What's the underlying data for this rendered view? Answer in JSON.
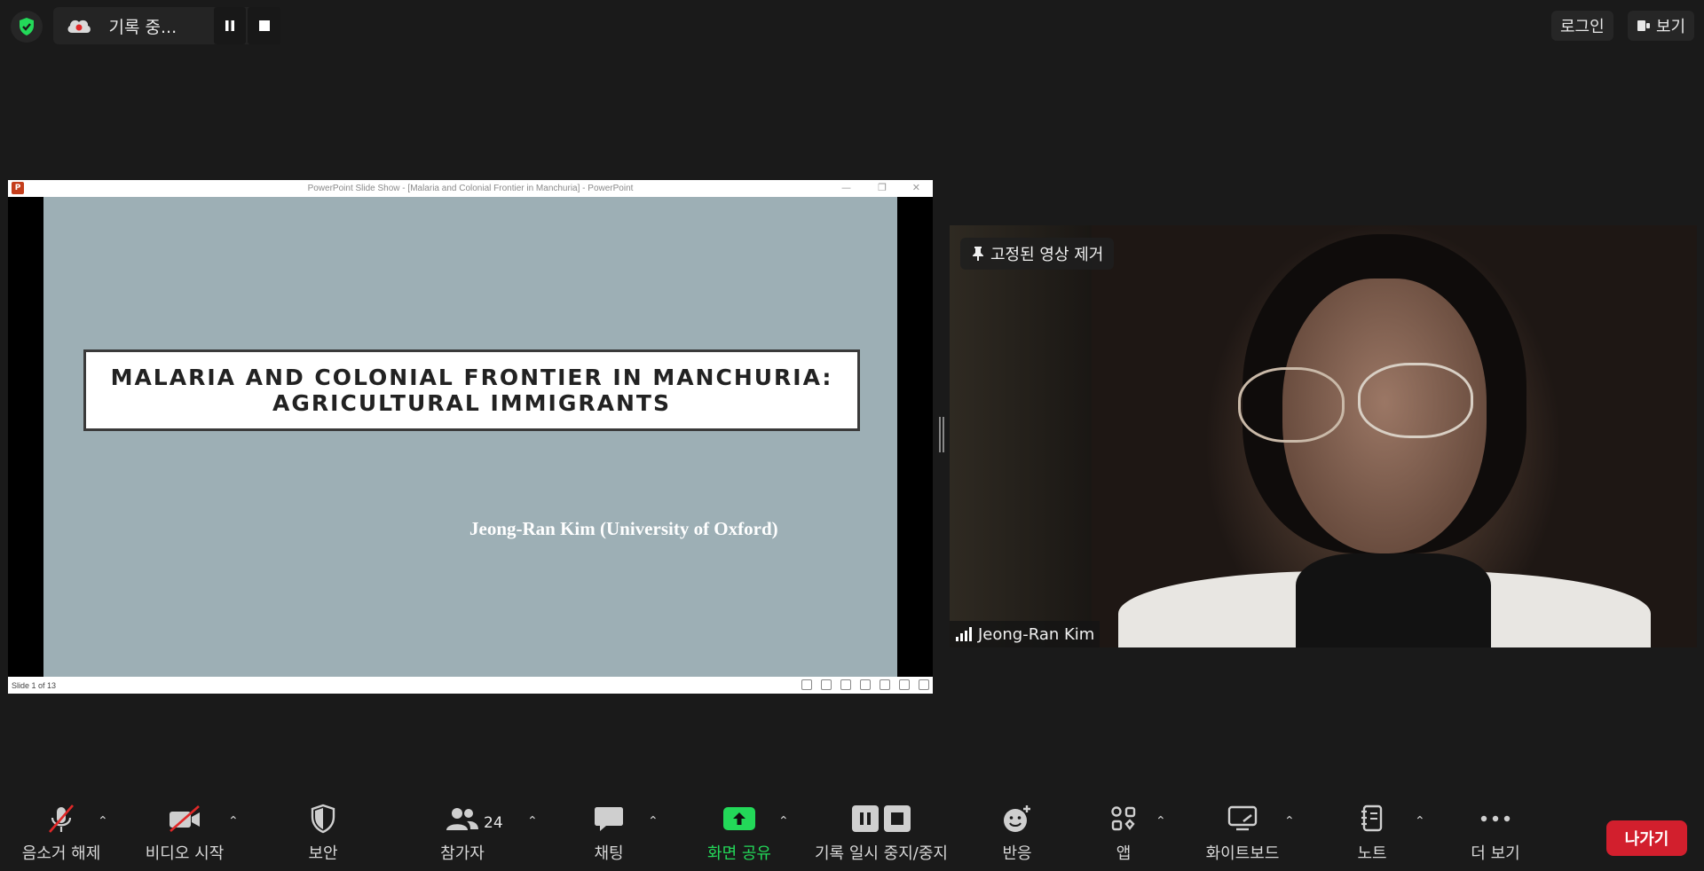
{
  "top": {
    "recording_label": "기록 중...",
    "login_label": "로그인",
    "view_label": "보기"
  },
  "share": {
    "window_title": "PowerPoint Slide Show - [Malaria and Colonial Frontier in Manchuria] - PowerPoint",
    "slide_title_line1": "MALARIA AND COLONIAL FRONTIER IN MANCHURIA:",
    "slide_title_line2": "AGRICULTURAL IMMIGRANTS",
    "slide_author": "Jeong-Ran Kim (University of Oxford)",
    "slide_counter": "Slide 1 of 13"
  },
  "video": {
    "unpin_label": "고정된 영상 제거",
    "participant_name": "Jeong-Ran Kim"
  },
  "toolbar": {
    "unmute": "음소거 해제",
    "start_video": "비디오 시작",
    "security": "보안",
    "participants": "참가자",
    "participants_count": "24",
    "chat": "채팅",
    "share_screen": "화면 공유",
    "record_pause_stop": "기록 일시 중지/중지",
    "reactions": "반응",
    "apps": "앱",
    "whiteboard": "화이트보드",
    "notes": "노트",
    "more": "더 보기",
    "leave": "나가기"
  },
  "colors": {
    "background": "#1a1a1a",
    "share_green": "#23d959",
    "leave_red": "#d21f2d",
    "muted_red": "#e02828",
    "slide_bg": "#9dafb5"
  }
}
